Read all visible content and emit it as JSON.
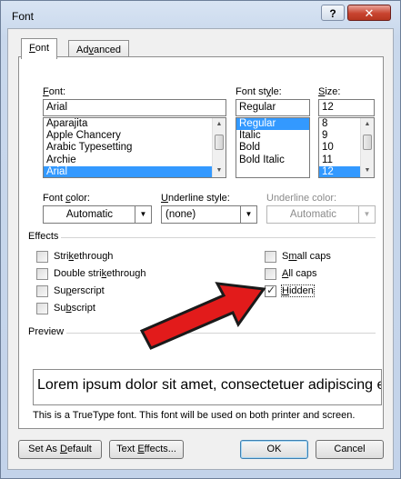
{
  "window": {
    "title": "Font",
    "help_label": "?",
    "close_label": "✕"
  },
  "tabs": [
    {
      "label": "Font",
      "underline": "F",
      "rest": "ont",
      "active": true
    },
    {
      "label": "Advanced",
      "underline": "v",
      "pre": "Ad",
      "rest": "anced",
      "active": false
    }
  ],
  "font": {
    "label_pre": "",
    "label_u": "F",
    "label_rest": "ont:",
    "value": "Arial",
    "items": [
      "Aparajita",
      "Apple Chancery",
      "Arabic Typesetting",
      "Archie",
      "Arial"
    ],
    "selected": "Arial"
  },
  "font_style": {
    "label_pre": "Font st",
    "label_u": "y",
    "label_rest": "le:",
    "value": "Regular",
    "items": [
      "Regular",
      "Italic",
      "Bold",
      "Bold Italic"
    ],
    "selected": "Regular"
  },
  "size": {
    "label_pre": "",
    "label_u": "S",
    "label_rest": "ize:",
    "value": "12",
    "items": [
      "8",
      "9",
      "10",
      "11",
      "12"
    ],
    "selected": "12"
  },
  "font_color": {
    "label_pre": "Font ",
    "label_u": "c",
    "label_rest": "olor:",
    "value": "Automatic"
  },
  "underline_style": {
    "label_pre": "",
    "label_u": "U",
    "label_rest": "nderline style:",
    "value": "(none)"
  },
  "underline_color": {
    "label": "Underline color:",
    "value": "Automatic",
    "disabled": true
  },
  "effects": {
    "title": "Effects",
    "left": [
      {
        "pre": "Stri",
        "u": "k",
        "rest": "ethrough",
        "checked": false
      },
      {
        "pre": "Double stri",
        "u": "k",
        "rest": "ethrough",
        "checked": false,
        "alt_u": "b"
      },
      {
        "pre": "Su",
        "u": "p",
        "rest": "erscript",
        "checked": false
      },
      {
        "pre": "Su",
        "u": "b",
        "rest": "script",
        "checked": false
      }
    ],
    "right": [
      {
        "pre": "S",
        "u": "m",
        "rest": "all caps",
        "checked": false
      },
      {
        "pre": "",
        "u": "A",
        "rest": "ll caps",
        "checked": false
      },
      {
        "pre": "",
        "u": "H",
        "rest": "idden",
        "checked": true
      }
    ]
  },
  "preview": {
    "title": "Preview",
    "text": "Lorem ipsum dolor sit amet, consectetuer adipiscing e",
    "note": "This is a TrueType font. This font will be used on both printer and screen."
  },
  "buttons": {
    "set_default": {
      "pre": "Set As ",
      "u": "D",
      "rest": "efault"
    },
    "text_effects": {
      "pre": "Text ",
      "u": "E",
      "rest": "ffects..."
    },
    "ok": "OK",
    "cancel": "Cancel"
  },
  "colors": {
    "selection": "#3399ff",
    "arrow_red": "#e21b1b"
  }
}
